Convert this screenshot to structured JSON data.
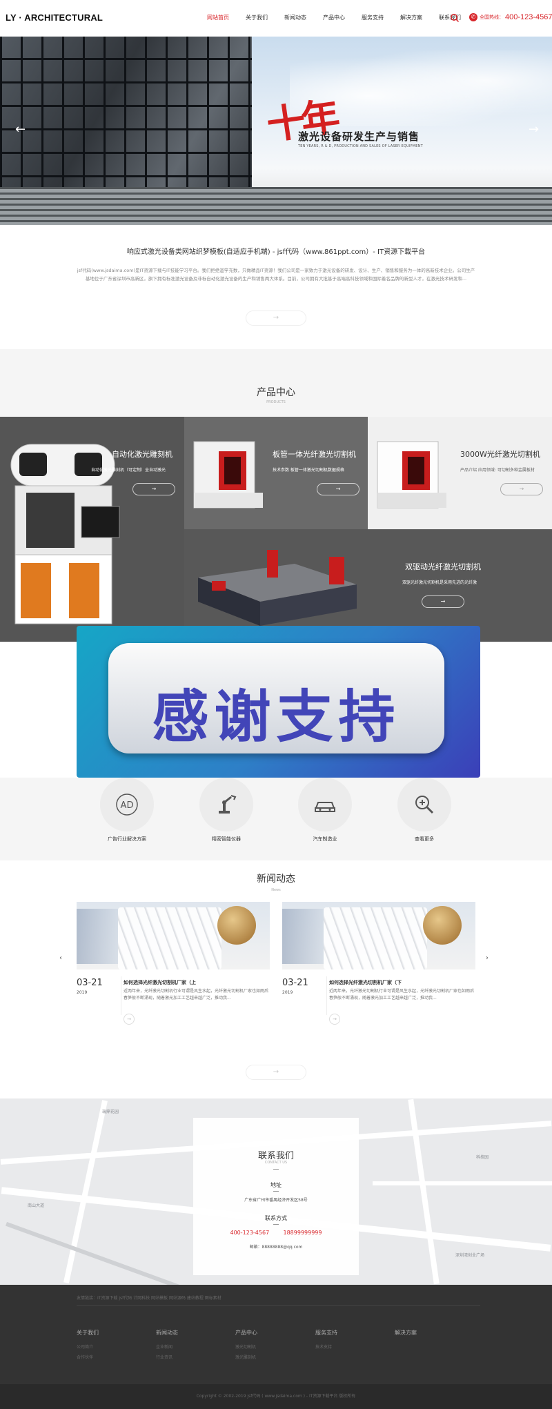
{
  "header": {
    "logo": "LY · ARCHITECTURAL",
    "nav": [
      "网站首页",
      "关于我们",
      "新闻动态",
      "产品中心",
      "服务支持",
      "解决方案",
      "联系我们"
    ],
    "hotline_label": "全国热线：",
    "hotline_number": "400-123-4567"
  },
  "banner": {
    "ten": "十年",
    "headline": "激光设备研发生产与销售",
    "subline": "TEN YEARS, R & D, PRODUCTION AND SALES OF LASER EQUIPMENT"
  },
  "intro": {
    "title": "响应式激光设备类网站织梦模板(自适应手机端) - jsf代码（www.861ppt.com）- IT资源下载平台",
    "text": "jsf代码(www.jsdaima.com)是IT资源下载与IT技能学习平台。我们拒绝滥竽充数，只做精品IT资源！我们公司是一家致力于激光设备的研发、设计、生产、销售和服务为一体的高新技术企业。公司生产基地位于广东省深圳市高新区，旗下拥有标准激光设备及非标自动化激光设备的生产和销售两大体系。目前，公司拥有大批基于高端高科技领域和国际着名品牌的新型人才，在激光技术研发和...",
    "more": "→"
  },
  "products": {
    "title": "产品中心",
    "subtitle": "PRODUCTS",
    "items": [
      {
        "name": "自动化激光雕刻机",
        "desc": "自动化激光雕刻机（可定制）全自动激光",
        "more": "→"
      },
      {
        "name": "板管一体光纤激光切割机",
        "desc": "技术参数 板管一体激光切割机数据规格",
        "more": "→"
      },
      {
        "name": "3000W光纤激光切割机",
        "desc": "产品介绍 应用领域: 可切割多种金属板材",
        "more": "→"
      },
      {
        "name": "双驱动光纤激光切割机",
        "desc": "双驱光纤激光切割机是采用先进的光纤激",
        "more": "→"
      }
    ]
  },
  "overlay": {
    "text": "感谢支持"
  },
  "solutions": [
    {
      "label": "广告行业解决方案",
      "icon": "ad-icon"
    },
    {
      "label": "精密智能仪器",
      "icon": "robot-arm-icon"
    },
    {
      "label": "汽车制造业",
      "icon": "car-icon"
    },
    {
      "label": "查看更多",
      "icon": "zoom-in-icon"
    }
  ],
  "solution_ad_text": "AD",
  "news": {
    "title": "新闻动态",
    "subtitle": "News",
    "prev": "‹",
    "next": "›",
    "items": [
      {
        "date": "03-21",
        "year": "2019",
        "title": "如何选择光纤激光切割机厂家（上",
        "desc": "近两年来，光纤激光切割机行业可谓是风生水起，光纤激光切割机厂家也如雨后春笋般不断涌现，随着激光加工工艺越来越广泛，推动我...",
        "more": "→"
      },
      {
        "date": "03-21",
        "year": "2019",
        "title": "如何选择光纤激光切割机厂家（下",
        "desc": "近两年来，光纤激光切割机行业可谓是风生水起，光纤激光切割机厂家也如雨后春笋般不断涌现，随着激光加工工艺越来越广泛，推动我...",
        "more": "→"
      }
    ],
    "more": "→"
  },
  "map_labels": [
    "瑞鼎花园",
    "深圳湾创业广场",
    "南山大道",
    "科技园"
  ],
  "contact": {
    "title": "联系我们",
    "subtitle": "CONTACT US",
    "address_label": "地址",
    "address": "广东省广州市番禺经济开发区58号",
    "method_label": "联系方式",
    "phone1": "400-123-4567",
    "phone2": "18899999999",
    "email": "邮箱：88888888@qq.com"
  },
  "footer": {
    "links": "友情链接：IT资源下载  jsf代码  计网科技  网站模板  网站源码  建站教程  图标素材",
    "columns": [
      {
        "heading": "关于我们",
        "items": [
          "公司简介",
          "合作伙伴"
        ]
      },
      {
        "heading": "新闻动态",
        "items": [
          "企业新闻",
          "行业资讯"
        ]
      },
      {
        "heading": "产品中心",
        "items": [
          "激光切割机",
          "激光雕刻机"
        ]
      },
      {
        "heading": "服务支持",
        "items": [
          "技术支持"
        ]
      },
      {
        "heading": "解决方案",
        "items": []
      }
    ],
    "copyright": "Copyright © 2002-2019 jsf代码 ( www.jsdaima.com ) - IT资源下载平台 版权所有"
  }
}
